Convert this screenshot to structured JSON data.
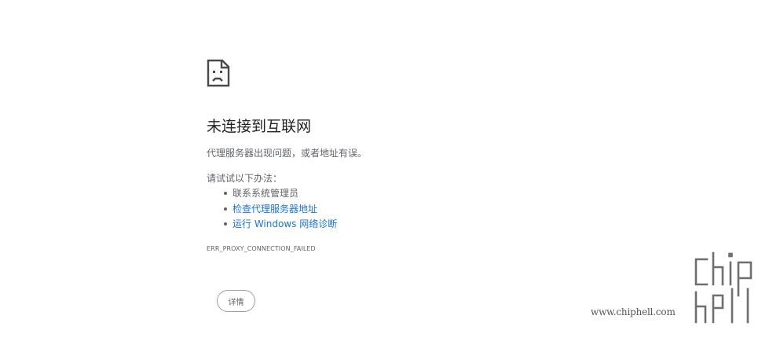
{
  "error": {
    "icon": "sad-page-icon",
    "title": "未连接到互联网",
    "message": "代理服务器出现问题，或者地址有误。",
    "suggestions_heading": "请试试以下办法：",
    "suggestions": [
      {
        "text": "联系系统管理员",
        "link": false
      },
      {
        "text": "检查代理服务器地址",
        "link": true
      },
      {
        "text": "运行 Windows 网络诊断",
        "link": true
      }
    ],
    "code": "ERR_PROXY_CONNECTION_FAILED",
    "details_label": "详情"
  },
  "watermark": {
    "url": "www.chiphell.com",
    "logo": "chiphell-logo"
  },
  "colors": {
    "text": "#202124",
    "secondary": "#5f6368",
    "link": "#1a73e8"
  }
}
